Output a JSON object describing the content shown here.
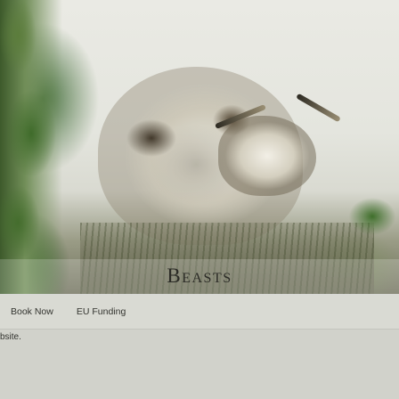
{
  "banner": {
    "title": "Beasts"
  },
  "nav": {
    "items": [
      {
        "label": "Book Now"
      },
      {
        "label": "EU Funding"
      }
    ]
  },
  "content": {
    "text_fragment": "bsite."
  }
}
